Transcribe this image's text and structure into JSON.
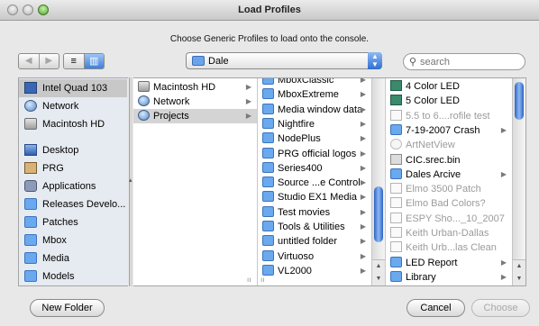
{
  "window": {
    "title": "Load Profiles",
    "message": "Choose Generic Profiles to load onto the console."
  },
  "toolbar": {
    "back_label": "◀",
    "forward_label": "▶",
    "list_view_label": "≡",
    "column_view_label": "▥",
    "location": "Dale",
    "search_placeholder": "search"
  },
  "sidebar": {
    "items": [
      {
        "label": "Intel Quad 103",
        "icon": "display-icon",
        "selected": true
      },
      {
        "label": "Network",
        "icon": "globe-icon"
      },
      {
        "label": "Macintosh HD",
        "icon": "disk-icon"
      },
      {
        "label": "Desktop",
        "icon": "desktop-icon"
      },
      {
        "label": "PRG",
        "icon": "home-icon"
      },
      {
        "label": "Applications",
        "icon": "applications-icon"
      },
      {
        "label": "Releases Develo...",
        "icon": "folder-icon"
      },
      {
        "label": "Patches",
        "icon": "folder-icon"
      },
      {
        "label": "Mbox",
        "icon": "folder-icon"
      },
      {
        "label": "Media",
        "icon": "folder-icon"
      },
      {
        "label": "Models",
        "icon": "folder-icon"
      }
    ]
  },
  "columns": {
    "col1": [
      {
        "label": "Macintosh HD",
        "icon": "disk-icon"
      },
      {
        "label": "Network",
        "icon": "globe-icon"
      },
      {
        "label": "Projects",
        "icon": "globe-icon",
        "selected": true
      }
    ],
    "col2": [
      {
        "label": "MboxClassic"
      },
      {
        "label": "MboxExtreme"
      },
      {
        "label": "Media window data"
      },
      {
        "label": "Nightfire"
      },
      {
        "label": "NodePlus"
      },
      {
        "label": "PRG official logos"
      },
      {
        "label": "Series400"
      },
      {
        "label": "Source ...e Control"
      },
      {
        "label": "Studio EX1 Media"
      },
      {
        "label": "Test movies"
      },
      {
        "label": "Tools & Utilities"
      },
      {
        "label": "untitled folder"
      },
      {
        "label": "Virtuoso"
      },
      {
        "label": "VL2000"
      }
    ],
    "col3": [
      {
        "label": "4 Color LED",
        "icon": "led-icon"
      },
      {
        "label": "5 Color LED",
        "icon": "led-icon"
      },
      {
        "label": "5.5 to 6....rofile test",
        "icon": "document-icon",
        "dim": true
      },
      {
        "label": "7-19-2007 Crash",
        "icon": "folder-icon",
        "arrow": true
      },
      {
        "label": "ArtNetView",
        "icon": "app-icon",
        "dim": true
      },
      {
        "label": "CIC.srec.bin",
        "icon": "binary-icon"
      },
      {
        "label": "Dales Arcive",
        "icon": "folder-icon",
        "arrow": true
      },
      {
        "label": "Elmo 3500 Patch",
        "icon": "document-icon",
        "dim": true
      },
      {
        "label": "Elmo Bad Colors?",
        "icon": "document-icon",
        "dim": true
      },
      {
        "label": "ESPY Sho..._10_2007",
        "icon": "document-icon",
        "dim": true
      },
      {
        "label": "Keith Urban-Dallas",
        "icon": "document-icon",
        "dim": true
      },
      {
        "label": "Keith Urb...las Clean",
        "icon": "document-icon",
        "dim": true
      },
      {
        "label": "LED Report",
        "icon": "folder-icon",
        "arrow": true
      },
      {
        "label": "Library",
        "icon": "folder-icon",
        "arrow": true
      }
    ]
  },
  "buttons": {
    "new_folder": "New Folder",
    "cancel": "Cancel",
    "choose": "Choose"
  }
}
